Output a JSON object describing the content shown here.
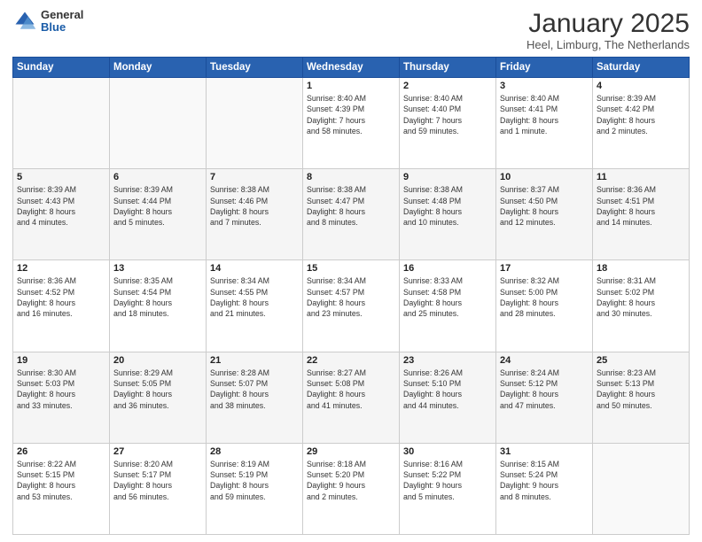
{
  "header": {
    "logo_general": "General",
    "logo_blue": "Blue",
    "month_title": "January 2025",
    "location": "Heel, Limburg, The Netherlands"
  },
  "days_of_week": [
    "Sunday",
    "Monday",
    "Tuesday",
    "Wednesday",
    "Thursday",
    "Friday",
    "Saturday"
  ],
  "weeks": [
    [
      {
        "day": "",
        "info": ""
      },
      {
        "day": "",
        "info": ""
      },
      {
        "day": "",
        "info": ""
      },
      {
        "day": "1",
        "info": "Sunrise: 8:40 AM\nSunset: 4:39 PM\nDaylight: 7 hours\nand 58 minutes."
      },
      {
        "day": "2",
        "info": "Sunrise: 8:40 AM\nSunset: 4:40 PM\nDaylight: 7 hours\nand 59 minutes."
      },
      {
        "day": "3",
        "info": "Sunrise: 8:40 AM\nSunset: 4:41 PM\nDaylight: 8 hours\nand 1 minute."
      },
      {
        "day": "4",
        "info": "Sunrise: 8:39 AM\nSunset: 4:42 PM\nDaylight: 8 hours\nand 2 minutes."
      }
    ],
    [
      {
        "day": "5",
        "info": "Sunrise: 8:39 AM\nSunset: 4:43 PM\nDaylight: 8 hours\nand 4 minutes."
      },
      {
        "day": "6",
        "info": "Sunrise: 8:39 AM\nSunset: 4:44 PM\nDaylight: 8 hours\nand 5 minutes."
      },
      {
        "day": "7",
        "info": "Sunrise: 8:38 AM\nSunset: 4:46 PM\nDaylight: 8 hours\nand 7 minutes."
      },
      {
        "day": "8",
        "info": "Sunrise: 8:38 AM\nSunset: 4:47 PM\nDaylight: 8 hours\nand 8 minutes."
      },
      {
        "day": "9",
        "info": "Sunrise: 8:38 AM\nSunset: 4:48 PM\nDaylight: 8 hours\nand 10 minutes."
      },
      {
        "day": "10",
        "info": "Sunrise: 8:37 AM\nSunset: 4:50 PM\nDaylight: 8 hours\nand 12 minutes."
      },
      {
        "day": "11",
        "info": "Sunrise: 8:36 AM\nSunset: 4:51 PM\nDaylight: 8 hours\nand 14 minutes."
      }
    ],
    [
      {
        "day": "12",
        "info": "Sunrise: 8:36 AM\nSunset: 4:52 PM\nDaylight: 8 hours\nand 16 minutes."
      },
      {
        "day": "13",
        "info": "Sunrise: 8:35 AM\nSunset: 4:54 PM\nDaylight: 8 hours\nand 18 minutes."
      },
      {
        "day": "14",
        "info": "Sunrise: 8:34 AM\nSunset: 4:55 PM\nDaylight: 8 hours\nand 21 minutes."
      },
      {
        "day": "15",
        "info": "Sunrise: 8:34 AM\nSunset: 4:57 PM\nDaylight: 8 hours\nand 23 minutes."
      },
      {
        "day": "16",
        "info": "Sunrise: 8:33 AM\nSunset: 4:58 PM\nDaylight: 8 hours\nand 25 minutes."
      },
      {
        "day": "17",
        "info": "Sunrise: 8:32 AM\nSunset: 5:00 PM\nDaylight: 8 hours\nand 28 minutes."
      },
      {
        "day": "18",
        "info": "Sunrise: 8:31 AM\nSunset: 5:02 PM\nDaylight: 8 hours\nand 30 minutes."
      }
    ],
    [
      {
        "day": "19",
        "info": "Sunrise: 8:30 AM\nSunset: 5:03 PM\nDaylight: 8 hours\nand 33 minutes."
      },
      {
        "day": "20",
        "info": "Sunrise: 8:29 AM\nSunset: 5:05 PM\nDaylight: 8 hours\nand 36 minutes."
      },
      {
        "day": "21",
        "info": "Sunrise: 8:28 AM\nSunset: 5:07 PM\nDaylight: 8 hours\nand 38 minutes."
      },
      {
        "day": "22",
        "info": "Sunrise: 8:27 AM\nSunset: 5:08 PM\nDaylight: 8 hours\nand 41 minutes."
      },
      {
        "day": "23",
        "info": "Sunrise: 8:26 AM\nSunset: 5:10 PM\nDaylight: 8 hours\nand 44 minutes."
      },
      {
        "day": "24",
        "info": "Sunrise: 8:24 AM\nSunset: 5:12 PM\nDaylight: 8 hours\nand 47 minutes."
      },
      {
        "day": "25",
        "info": "Sunrise: 8:23 AM\nSunset: 5:13 PM\nDaylight: 8 hours\nand 50 minutes."
      }
    ],
    [
      {
        "day": "26",
        "info": "Sunrise: 8:22 AM\nSunset: 5:15 PM\nDaylight: 8 hours\nand 53 minutes."
      },
      {
        "day": "27",
        "info": "Sunrise: 8:20 AM\nSunset: 5:17 PM\nDaylight: 8 hours\nand 56 minutes."
      },
      {
        "day": "28",
        "info": "Sunrise: 8:19 AM\nSunset: 5:19 PM\nDaylight: 8 hours\nand 59 minutes."
      },
      {
        "day": "29",
        "info": "Sunrise: 8:18 AM\nSunset: 5:20 PM\nDaylight: 9 hours\nand 2 minutes."
      },
      {
        "day": "30",
        "info": "Sunrise: 8:16 AM\nSunset: 5:22 PM\nDaylight: 9 hours\nand 5 minutes."
      },
      {
        "day": "31",
        "info": "Sunrise: 8:15 AM\nSunset: 5:24 PM\nDaylight: 9 hours\nand 8 minutes."
      },
      {
        "day": "",
        "info": ""
      }
    ]
  ]
}
